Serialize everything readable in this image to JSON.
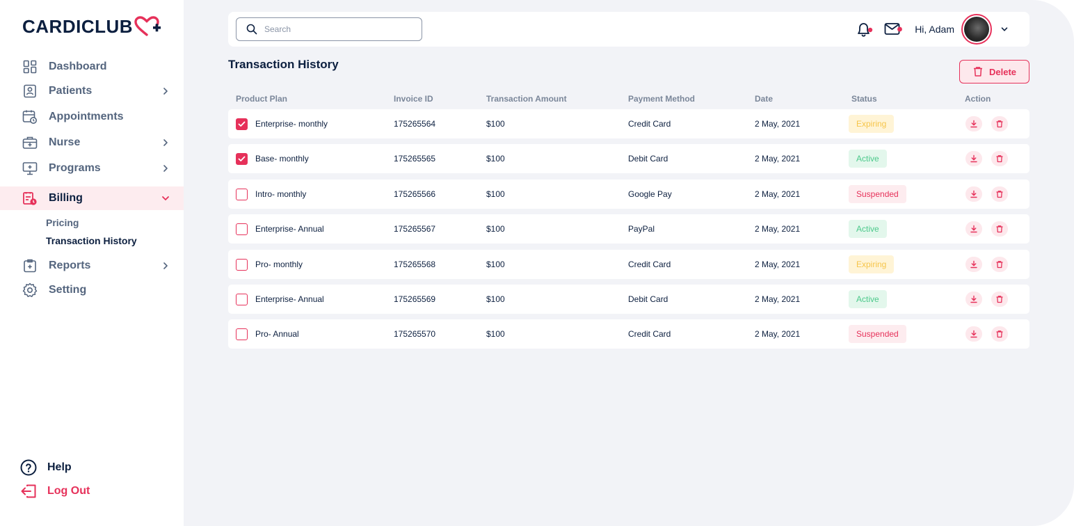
{
  "brand": {
    "name": "CARDICLUB"
  },
  "colors": {
    "accent": "#e6315a",
    "navy": "#0c1f3f",
    "muted": "#54657e",
    "background": "#f2f3f7"
  },
  "sidebar": {
    "items": [
      {
        "label": "Dashboard",
        "icon": "dashboard-icon"
      },
      {
        "label": "Patients",
        "icon": "patients-icon",
        "has_chevron": true
      },
      {
        "label": "Appointments",
        "icon": "calendar-icon"
      },
      {
        "label": "Nurse",
        "icon": "medical-kit-icon",
        "has_chevron": true
      },
      {
        "label": "Programs",
        "icon": "monitor-icon",
        "has_chevron": true
      },
      {
        "label": "Billing",
        "icon": "billing-icon",
        "active": true,
        "expanded": true
      },
      {
        "label": "Reports",
        "icon": "report-icon",
        "has_chevron": true
      },
      {
        "label": "Setting",
        "icon": "gear-icon"
      }
    ],
    "billing_sub": [
      {
        "label": "Pricing"
      },
      {
        "label": "Transaction History",
        "current": true
      }
    ],
    "help_label": "Help",
    "logout_label": "Log Out"
  },
  "topbar": {
    "search_placeholder": "Search",
    "greeting": "Hi, Adam"
  },
  "page": {
    "title": "Transaction History",
    "delete_label": "Delete"
  },
  "table": {
    "headers": [
      "Product Plan",
      "Invoice ID",
      "Transaction Amount",
      "Payment Method",
      "Date",
      "Status",
      "Action"
    ],
    "rows": [
      {
        "checked": true,
        "plan": "Enterprise- monthly",
        "invoice": "175265564",
        "amount": "$100",
        "method": "Credit Card",
        "date": "2 May, 2021",
        "status": "Expiring"
      },
      {
        "checked": true,
        "plan": "Base- monthly",
        "invoice": "175265565",
        "amount": "$100",
        "method": "Debit Card",
        "date": "2 May, 2021",
        "status": "Active"
      },
      {
        "checked": false,
        "plan": "Intro- monthly",
        "invoice": "175265566",
        "amount": "$100",
        "method": "Google Pay",
        "date": "2 May, 2021",
        "status": "Suspended"
      },
      {
        "checked": false,
        "plan": "Enterprise- Annual",
        "invoice": "175265567",
        "amount": "$100",
        "method": "PayPal",
        "date": "2 May, 2021",
        "status": "Active"
      },
      {
        "checked": false,
        "plan": "Pro- monthly",
        "invoice": "175265568",
        "amount": "$100",
        "method": "Credit Card",
        "date": "2 May, 2021",
        "status": "Expiring"
      },
      {
        "checked": false,
        "plan": "Enterprise- Annual",
        "invoice": "175265569",
        "amount": "$100",
        "method": "Debit Card",
        "date": "2 May, 2021",
        "status": "Active"
      },
      {
        "checked": false,
        "plan": "Pro- Annual",
        "invoice": "175265570",
        "amount": "$100",
        "method": "Credit Card",
        "date": "2 May, 2021",
        "status": "Suspended"
      }
    ]
  }
}
